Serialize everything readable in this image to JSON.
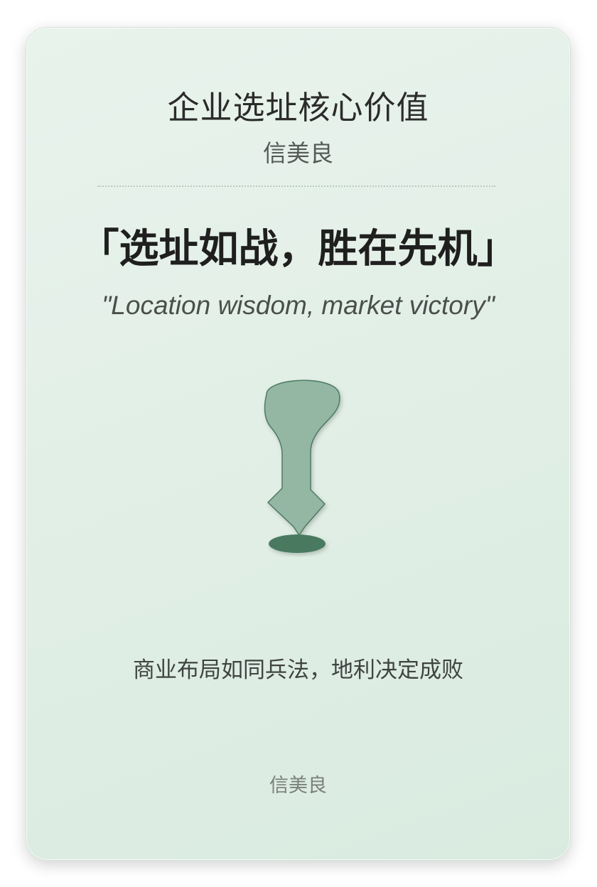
{
  "card": {
    "title": "企业选址核心价值",
    "subtitle": "信美良",
    "motto": "「选址如战，胜在先机」",
    "motto_en": "\"Location wisdom, market victory\"",
    "icon": "map-pin-icon",
    "tagline": "商业布局如同兵法，地利决定成败",
    "footer": "信美良"
  },
  "colors": {
    "pin_fill": "#93b7a2",
    "pin_stroke": "#4f7a62",
    "pin_base": "#4a7a60",
    "background": "#e2efe7"
  }
}
